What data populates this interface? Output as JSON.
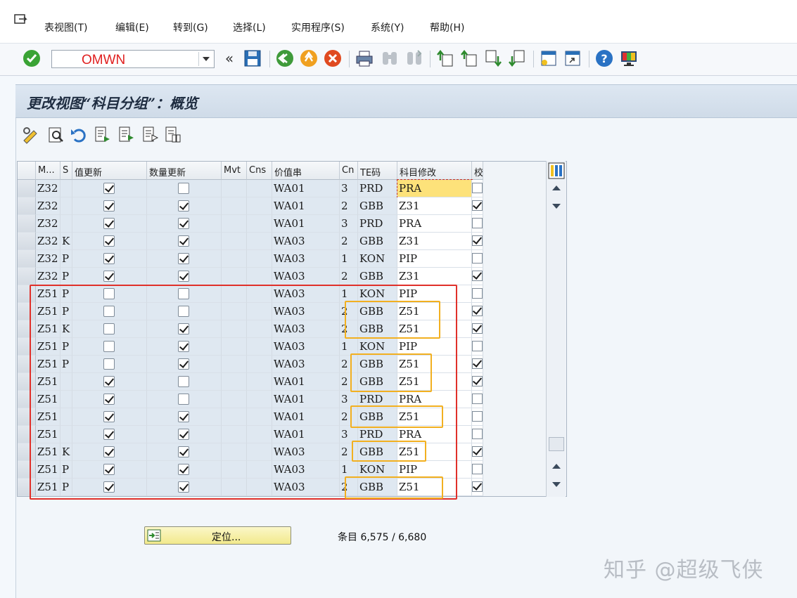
{
  "menu": {
    "items": [
      "表视图(T)",
      "编辑(E)",
      "转到(G)",
      "选择(L)",
      "实用程序(S)",
      "系统(Y)",
      "帮助(H)"
    ]
  },
  "toolbar": {
    "command_value": "OMWN",
    "icons": [
      "enter-icon",
      "back-double-icon",
      "save-icon",
      "back-icon",
      "exit-icon",
      "cancel-icon",
      "print-icon",
      "find-icon",
      "find-next-icon",
      "first-page-icon",
      "prev-page-icon",
      "next-page-icon",
      "last-page-icon",
      "new-session-icon",
      "shortcut-icon",
      "help-icon",
      "layout-icon"
    ]
  },
  "page_title": "更改视图“科目分组”：概览",
  "table": {
    "columns": [
      "M...",
      "S",
      "值更新",
      "数量更新",
      "Mvt",
      "Cns",
      "价值串",
      "Cn",
      "TE码",
      "科目修改",
      "校"
    ],
    "rows": [
      {
        "m": "Z32",
        "s": "",
        "val": true,
        "qty": false,
        "mvt": "",
        "cns": "",
        "vs": "WA01",
        "cn": "3",
        "te": "PRD",
        "acct": "PRA",
        "chk": false,
        "focus": true
      },
      {
        "m": "Z32",
        "s": "",
        "val": true,
        "qty": true,
        "mvt": "",
        "cns": "",
        "vs": "WA01",
        "cn": "2",
        "te": "GBB",
        "acct": "Z31",
        "chk": true
      },
      {
        "m": "Z32",
        "s": "",
        "val": true,
        "qty": true,
        "mvt": "",
        "cns": "",
        "vs": "WA01",
        "cn": "3",
        "te": "PRD",
        "acct": "PRA",
        "chk": false
      },
      {
        "m": "Z32",
        "s": "K",
        "val": true,
        "qty": true,
        "mvt": "",
        "cns": "",
        "vs": "WA03",
        "cn": "2",
        "te": "GBB",
        "acct": "Z31",
        "chk": true
      },
      {
        "m": "Z32",
        "s": "P",
        "val": true,
        "qty": true,
        "mvt": "",
        "cns": "",
        "vs": "WA03",
        "cn": "1",
        "te": "KON",
        "acct": "PIP",
        "chk": false
      },
      {
        "m": "Z32",
        "s": "P",
        "val": true,
        "qty": true,
        "mvt": "",
        "cns": "",
        "vs": "WA03",
        "cn": "2",
        "te": "GBB",
        "acct": "Z31",
        "chk": true
      },
      {
        "m": "Z51",
        "s": "P",
        "val": false,
        "qty": false,
        "mvt": "",
        "cns": "",
        "vs": "WA03",
        "cn": "1",
        "te": "KON",
        "acct": "PIP",
        "chk": false
      },
      {
        "m": "Z51",
        "s": "P",
        "val": false,
        "qty": false,
        "mvt": "",
        "cns": "",
        "vs": "WA03",
        "cn": "2",
        "te": "GBB",
        "acct": "Z51",
        "chk": true
      },
      {
        "m": "Z51",
        "s": "K",
        "val": false,
        "qty": true,
        "mvt": "",
        "cns": "",
        "vs": "WA03",
        "cn": "2",
        "te": "GBB",
        "acct": "Z51",
        "chk": true
      },
      {
        "m": "Z51",
        "s": "P",
        "val": false,
        "qty": true,
        "mvt": "",
        "cns": "",
        "vs": "WA03",
        "cn": "1",
        "te": "KON",
        "acct": "PIP",
        "chk": false
      },
      {
        "m": "Z51",
        "s": "P",
        "val": false,
        "qty": true,
        "mvt": "",
        "cns": "",
        "vs": "WA03",
        "cn": "2",
        "te": "GBB",
        "acct": "Z51",
        "chk": true
      },
      {
        "m": "Z51",
        "s": "",
        "val": true,
        "qty": false,
        "mvt": "",
        "cns": "",
        "vs": "WA01",
        "cn": "2",
        "te": "GBB",
        "acct": "Z51",
        "chk": true
      },
      {
        "m": "Z51",
        "s": "",
        "val": true,
        "qty": false,
        "mvt": "",
        "cns": "",
        "vs": "WA01",
        "cn": "3",
        "te": "PRD",
        "acct": "PRA",
        "chk": false
      },
      {
        "m": "Z51",
        "s": "",
        "val": true,
        "qty": true,
        "mvt": "",
        "cns": "",
        "vs": "WA01",
        "cn": "2",
        "te": "GBB",
        "acct": "Z51",
        "chk": false
      },
      {
        "m": "Z51",
        "s": "",
        "val": true,
        "qty": true,
        "mvt": "",
        "cns": "",
        "vs": "WA01",
        "cn": "3",
        "te": "PRD",
        "acct": "PRA",
        "chk": false
      },
      {
        "m": "Z51",
        "s": "K",
        "val": true,
        "qty": true,
        "mvt": "",
        "cns": "",
        "vs": "WA03",
        "cn": "2",
        "te": "GBB",
        "acct": "Z51",
        "chk": true
      },
      {
        "m": "Z51",
        "s": "P",
        "val": true,
        "qty": true,
        "mvt": "",
        "cns": "",
        "vs": "WA03",
        "cn": "1",
        "te": "KON",
        "acct": "PIP",
        "chk": false
      },
      {
        "m": "Z51",
        "s": "P",
        "val": true,
        "qty": true,
        "mvt": "",
        "cns": "",
        "vs": "WA03",
        "cn": "2",
        "te": "GBB",
        "acct": "Z51",
        "chk": true
      }
    ]
  },
  "footer": {
    "position_button": "定位...",
    "entries": "条目 6,575 / 6,680"
  },
  "watermark": "知乎 @超级飞侠",
  "colors": {
    "highlight_red": "#e0302a",
    "highlight_orange": "#f2b020",
    "command_text": "#e02020",
    "focus_cell": "#fde27a"
  }
}
